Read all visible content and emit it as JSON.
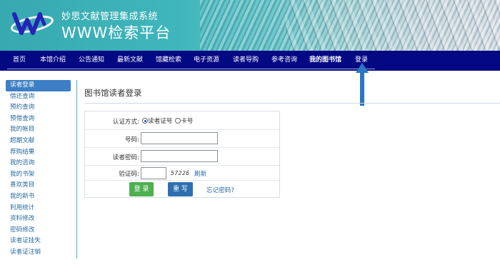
{
  "header": {
    "subtitle": "妙思文献管理集成系统",
    "title": "WWW检索平台"
  },
  "nav": {
    "items": [
      "首页",
      "本馆介绍",
      "公告通知",
      "最新文献",
      "馆藏检索",
      "电子资源",
      "读者导购",
      "参考咨询",
      "我的图书馆",
      "登录"
    ]
  },
  "sidebar": {
    "items": [
      "读者登录",
      "借还查询",
      "预约查询",
      "预借查询",
      "我的帐目",
      "超期文献",
      "荐购结果",
      "我的咨询",
      "我的书架",
      "喜欢类目",
      "我的新书",
      "利用统计",
      "资料修改",
      "密码修改",
      "读者证挂失",
      "读者证注销"
    ]
  },
  "main": {
    "title": "图书馆读者登录"
  },
  "form": {
    "auth_label": "认证方式:",
    "auth_options": [
      "读者证号",
      "卡号"
    ],
    "number_label": "号码:",
    "password_label": "读者密码:",
    "captcha_label": "验证码:",
    "captcha_text": "57226",
    "refresh_link": "刷新",
    "login_button": "登 录",
    "reset_button": "重 写",
    "forgot_link": "忘记密码?"
  },
  "colors": {
    "nav_bg": "#030883",
    "accent": "#3c7fc4",
    "login_green": "#4cb04f",
    "reset_blue": "#2e6fb0",
    "arrow": "#2a76c6"
  }
}
